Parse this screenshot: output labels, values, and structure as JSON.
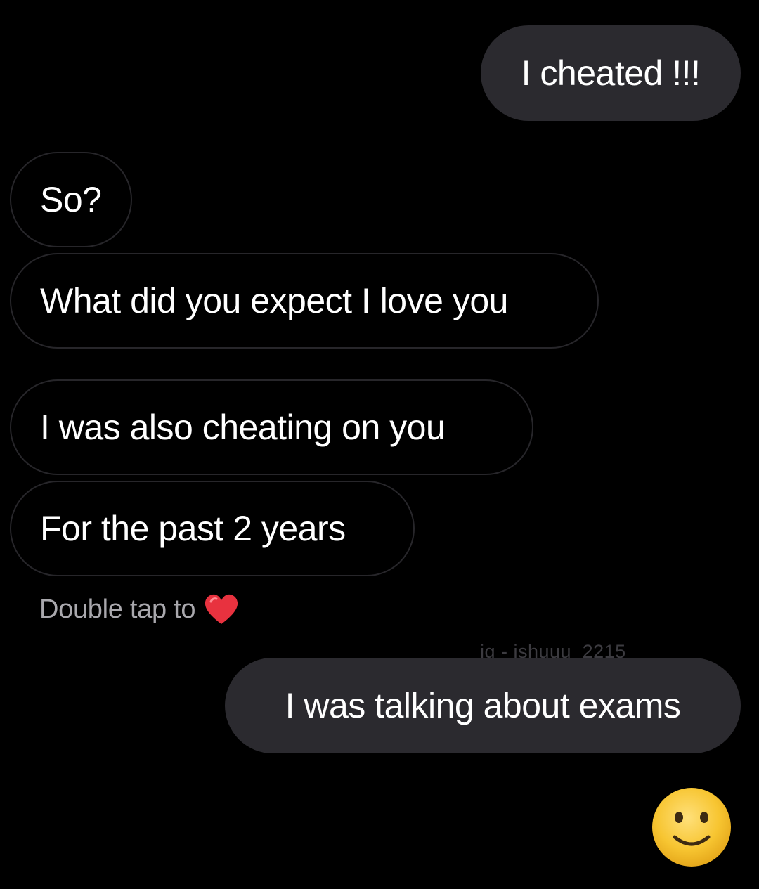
{
  "messages": {
    "sent_1": "I cheated !!!",
    "received_1": "So?",
    "received_2": "What did you expect I love you",
    "received_3": "I was also cheating on you",
    "received_4": "For the past 2 years",
    "sent_2": "I was talking about exams"
  },
  "reaction_hint": {
    "label": "Double tap to",
    "icon": "heart-icon",
    "icon_color": "#e8323f"
  },
  "watermark": "ig - ishuuu_2215",
  "emoji": {
    "icon": "slightly-smiling-face-icon",
    "color": "#f7c531"
  },
  "colors": {
    "background": "#000000",
    "sent_bubble": "#2b2a2f",
    "received_bubble_border": "#27262a",
    "hint_text": "#a9a8ad"
  }
}
